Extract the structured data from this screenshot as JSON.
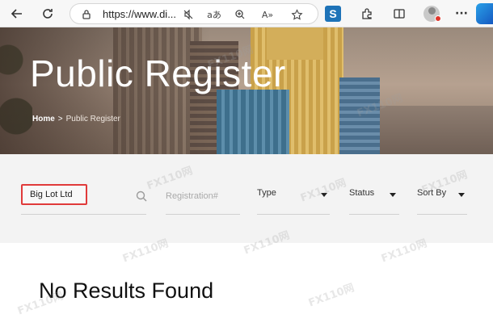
{
  "browser": {
    "url": "https://www.di...",
    "icons": [
      "back-icon",
      "refresh-icon",
      "lock-icon",
      "mute-icon",
      "translate-icon",
      "zoom-icon",
      "read-aloud-icon",
      "favorite-icon",
      "extension-s-icon",
      "extensions-icon",
      "split-screen-icon",
      "profile-icon",
      "more-icon",
      "edge-icon"
    ]
  },
  "hero": {
    "title": "Public Register",
    "breadcrumb": {
      "home": "Home",
      "separator": ">",
      "current": "Public Register"
    }
  },
  "filters": {
    "search_value": "Big Lot Ltd",
    "registration_placeholder": "Registration#",
    "type_label": "Type",
    "status_label": "Status",
    "sort_label": "Sort By"
  },
  "results": {
    "message": "No Results Found"
  },
  "colors": {
    "highlight_border": "#e03a3a",
    "hero_text": "#ffffff"
  },
  "watermark": "FX110网"
}
